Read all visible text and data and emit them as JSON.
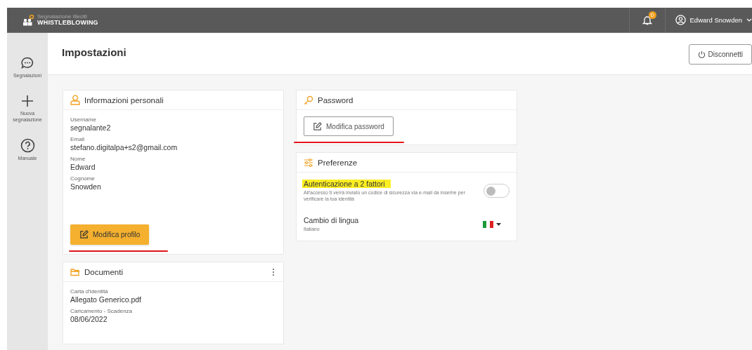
{
  "topbar": {
    "logo_subtitle": "Segnalazione Illeciti",
    "logo_title": "WHISTLEBLOWING",
    "notification_count": "0",
    "user_name": "Edward Snowden"
  },
  "sidebar": {
    "items": [
      {
        "label": "Segnalazioni",
        "kind": "chat"
      },
      {
        "label": "Nuova segnalazione",
        "kind": "plus"
      },
      {
        "label": "Manuale",
        "kind": "help"
      }
    ]
  },
  "page": {
    "title": "Impostazioni",
    "logout": "Disconnetti"
  },
  "personal_info": {
    "title": "Informazioni personali",
    "fields": [
      {
        "label": "Username",
        "value": "segnalante2"
      },
      {
        "label": "Email",
        "value": "stefano.digitalpa+s2@gmail.com"
      },
      {
        "label": "Nome",
        "value": "Edward"
      },
      {
        "label": "Cognome",
        "value": "Snowden"
      }
    ],
    "button": "Modifica profilo"
  },
  "documents": {
    "title": "Documenti",
    "fields": [
      {
        "label": "Carta d'identità",
        "value": "Allegato Generico.pdf"
      },
      {
        "label": "Caricamento - Scadenza",
        "value": "08/06/2022"
      }
    ]
  },
  "password": {
    "title": "Password",
    "button": "Modifica password"
  },
  "preferences": {
    "title": "Preferenze",
    "two_factor": {
      "label": "Autenticazione a 2 fattori",
      "description": "All'accesso ti verrà inviato un codice di sicurezza via e-mail da inserire per verificare la tua identità",
      "on": false
    },
    "language": {
      "label": "Cambio di lingua",
      "value": "Italiano"
    }
  }
}
